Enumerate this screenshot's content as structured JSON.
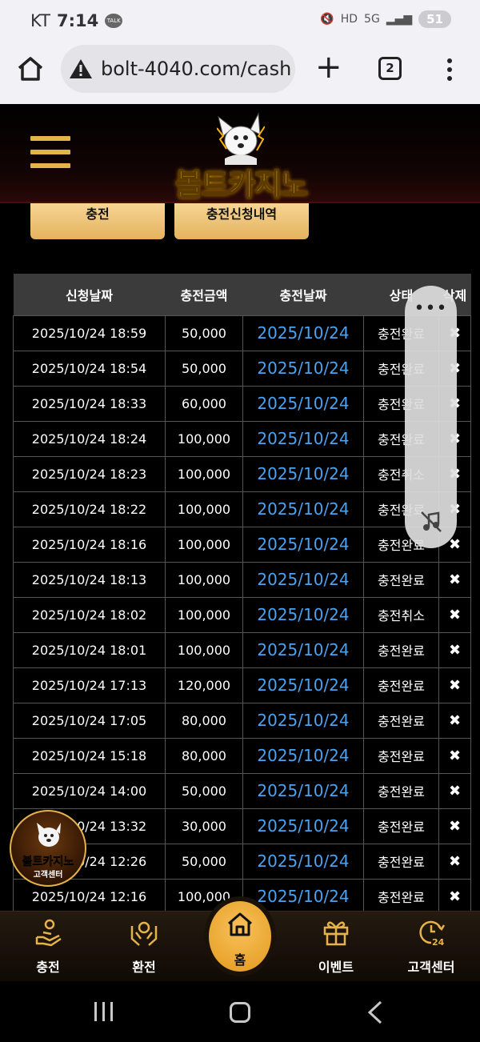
{
  "statusbar": {
    "carrier": "KT",
    "time": "7:14",
    "kakao": "TALK",
    "hd": "HD",
    "net": "5G",
    "battery": "51"
  },
  "browser": {
    "url": "bolt-4040.com/cash",
    "tab_count": "2"
  },
  "site": {
    "logo_text": "볼트카지노",
    "tabs": [
      {
        "label": "충전"
      },
      {
        "label": "충전신청내역"
      }
    ]
  },
  "table": {
    "headers": [
      "신청날짜",
      "충전금액",
      "충전날짜",
      "상태",
      "삭제"
    ],
    "rows": [
      {
        "req": "2025/10/24 18:59",
        "amount": "50,000",
        "date": "2025/10/24",
        "status": "충전완료",
        "del": "✖"
      },
      {
        "req": "2025/10/24 18:54",
        "amount": "50,000",
        "date": "2025/10/24",
        "status": "충전완료",
        "del": "✖"
      },
      {
        "req": "2025/10/24 18:33",
        "amount": "60,000",
        "date": "2025/10/24",
        "status": "충전완료",
        "del": "✖"
      },
      {
        "req": "2025/10/24 18:24",
        "amount": "100,000",
        "date": "2025/10/24",
        "status": "충전완료",
        "del": "✖"
      },
      {
        "req": "2025/10/24 18:23",
        "amount": "100,000",
        "date": "2025/10/24",
        "status": "충전취소",
        "del": "✖"
      },
      {
        "req": "2025/10/24 18:22",
        "amount": "100,000",
        "date": "2025/10/24",
        "status": "충전완료",
        "del": "✖"
      },
      {
        "req": "2025/10/24 18:16",
        "amount": "100,000",
        "date": "2025/10/24",
        "status": "충전완료",
        "del": "✖"
      },
      {
        "req": "2025/10/24 18:13",
        "amount": "100,000",
        "date": "2025/10/24",
        "status": "충전완료",
        "del": "✖"
      },
      {
        "req": "2025/10/24 18:02",
        "amount": "100,000",
        "date": "2025/10/24",
        "status": "충전취소",
        "del": "✖"
      },
      {
        "req": "2025/10/24 18:01",
        "amount": "100,000",
        "date": "2025/10/24",
        "status": "충전완료",
        "del": "✖"
      },
      {
        "req": "2025/10/24 17:13",
        "amount": "120,000",
        "date": "2025/10/24",
        "status": "충전완료",
        "del": "✖"
      },
      {
        "req": "2025/10/24 17:05",
        "amount": "80,000",
        "date": "2025/10/24",
        "status": "충전완료",
        "del": "✖"
      },
      {
        "req": "2025/10/24 15:18",
        "amount": "80,000",
        "date": "2025/10/24",
        "status": "충전완료",
        "del": "✖"
      },
      {
        "req": "2025/10/24 14:00",
        "amount": "50,000",
        "date": "2025/10/24",
        "status": "충전완료",
        "del": "✖"
      },
      {
        "req": "2025/10/24 13:32",
        "amount": "30,000",
        "date": "2025/10/24",
        "status": "충전완료",
        "del": "✖"
      },
      {
        "req": "2025/10/24 12:26",
        "amount": "50,000",
        "date": "2025/10/24",
        "status": "충전완료",
        "del": "✖"
      },
      {
        "req": "2025/10/24 12:16",
        "amount": "100,000",
        "date": "2025/10/24",
        "status": "충전완료",
        "del": "✖"
      }
    ]
  },
  "float_panel": {
    "dots": "•••"
  },
  "cs_badge": {
    "brand": "볼트카지노",
    "label": "고객센터"
  },
  "bottomnav": {
    "items": [
      {
        "label": "충전",
        "icon": "charge-hand-icon"
      },
      {
        "label": "환전",
        "icon": "exchange-hands-icon"
      },
      {
        "label": "홈",
        "icon": "home-icon"
      },
      {
        "label": "이벤트",
        "icon": "gift-icon"
      },
      {
        "label": "고객센터",
        "icon": "support-24-icon"
      }
    ]
  },
  "colors": {
    "accent_gold": "#e6b24a",
    "date_blue": "#4aa2f0",
    "header_gray": "#3b3b3b"
  }
}
